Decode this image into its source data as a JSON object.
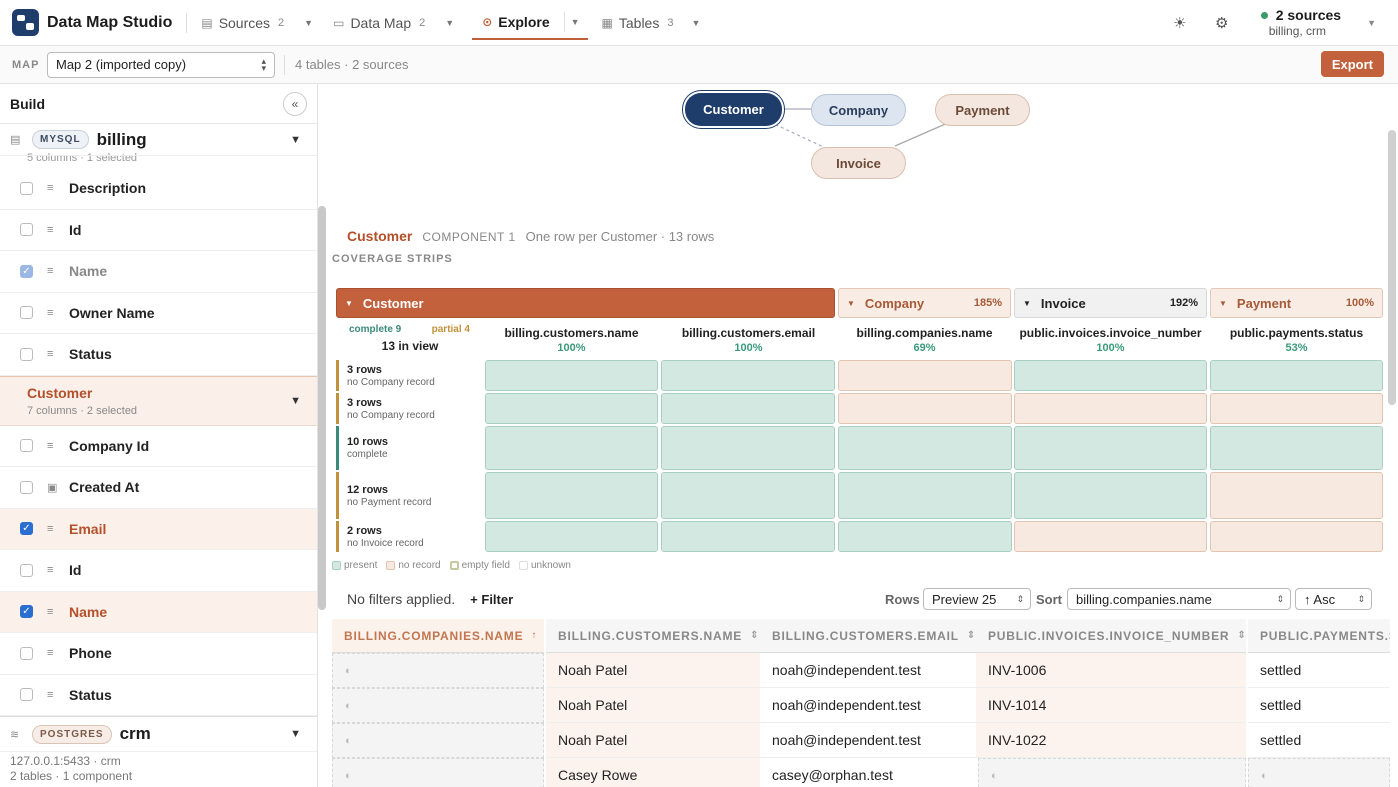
{
  "app": {
    "title": "Data Map Studio"
  },
  "tabs": [
    {
      "label": "Sources",
      "count": "2",
      "icon": "database-icon"
    },
    {
      "label": "Data Map",
      "count": "2",
      "icon": "folder-icon"
    },
    {
      "label": "Explore",
      "icon": "compass-icon"
    },
    {
      "label": "Tables",
      "count": "3",
      "icon": "grid-icon"
    }
  ],
  "status": {
    "sources": "2 sources",
    "names": "billing, crm",
    "color": "#3a9a6a"
  },
  "mapbar": {
    "label": "MAP",
    "selected": "Map 2 (imported copy)",
    "info": "4 tables · 2 sources",
    "export": "Export"
  },
  "sidebar": {
    "title": "Build",
    "billing": {
      "engine": "MYSQL",
      "name": "billing",
      "meta": "5 columns · 1 selected",
      "columns": [
        {
          "name": "Description",
          "checked": false
        },
        {
          "name": "Id",
          "checked": false
        },
        {
          "name": "Name",
          "checked": true,
          "dim": true
        },
        {
          "name": "Owner Name",
          "checked": false
        },
        {
          "name": "Status",
          "checked": false
        }
      ]
    },
    "customer": {
      "name": "Customer",
      "meta": "7 columns · 2 selected",
      "columns": [
        {
          "name": "Company Id",
          "checked": false
        },
        {
          "name": "Created At",
          "checked": false
        },
        {
          "name": "Email",
          "checked": true
        },
        {
          "name": "Id",
          "checked": false
        },
        {
          "name": "Name",
          "checked": true
        },
        {
          "name": "Phone",
          "checked": false
        },
        {
          "name": "Status",
          "checked": false
        }
      ]
    },
    "crm": {
      "engine": "POSTGRES",
      "name": "crm",
      "host": "127.0.0.1:5433 · crm",
      "meta": "2 tables · 1 component"
    }
  },
  "graph": {
    "nodes": [
      "Customer",
      "Company",
      "Payment",
      "Invoice"
    ]
  },
  "component": {
    "title": "Customer",
    "tag": "COMPONENT 1",
    "desc": "One row per Customer · 13 rows"
  },
  "coverage": {
    "label": "COVERAGE STRIPS",
    "groups": [
      {
        "name": "Customer",
        "pct": ""
      },
      {
        "name": "Company",
        "pct": "185%"
      },
      {
        "name": "Invoice",
        "pct": "192%"
      },
      {
        "name": "Payment",
        "pct": "100%"
      }
    ],
    "complete": "complete 9",
    "partial": "partial 4",
    "inview": "13 in view",
    "columns": [
      {
        "name": "billing.customers.name",
        "pct": "100%"
      },
      {
        "name": "billing.customers.email",
        "pct": "100%"
      },
      {
        "name": "billing.companies.name",
        "pct": "69%"
      },
      {
        "name": "public.invoices.invoice_number",
        "pct": "100%"
      },
      {
        "name": "public.payments.status",
        "pct": "53%"
      }
    ],
    "rows": [
      {
        "count": "3 rows",
        "note": "no Company record"
      },
      {
        "count": "3 rows",
        "note": "no Company record"
      },
      {
        "count": "10 rows",
        "note": "complete"
      },
      {
        "count": "12 rows",
        "note": "no Payment record"
      },
      {
        "count": "2 rows",
        "note": "no Invoice record"
      }
    ],
    "legend": [
      "present",
      "no record",
      "empty field",
      "unknown"
    ]
  },
  "filters": {
    "none": "No filters applied.",
    "add": "+ Filter",
    "rows_label": "Rows",
    "rows_value": "Preview 25",
    "sort_label": "Sort",
    "sort_value": "billing.companies.name",
    "order": "↑ Asc"
  },
  "table": {
    "headers": [
      "BILLING.COMPANIES.NAME",
      "BILLING.CUSTOMERS.NAME",
      "BILLING.CUSTOMERS.EMAIL",
      "PUBLIC.INVOICES.INVOICE_NUMBER",
      "PUBLIC.PAYMENTS.S"
    ],
    "rows": [
      [
        "",
        "Noah Patel",
        "noah@independent.test",
        "INV-1006",
        "settled"
      ],
      [
        "",
        "Noah Patel",
        "noah@independent.test",
        "INV-1014",
        "settled"
      ],
      [
        "",
        "Noah Patel",
        "noah@independent.test",
        "INV-1022",
        "settled"
      ],
      [
        "",
        "Casey Rowe",
        "casey@orphan.test",
        "",
        ""
      ]
    ]
  }
}
